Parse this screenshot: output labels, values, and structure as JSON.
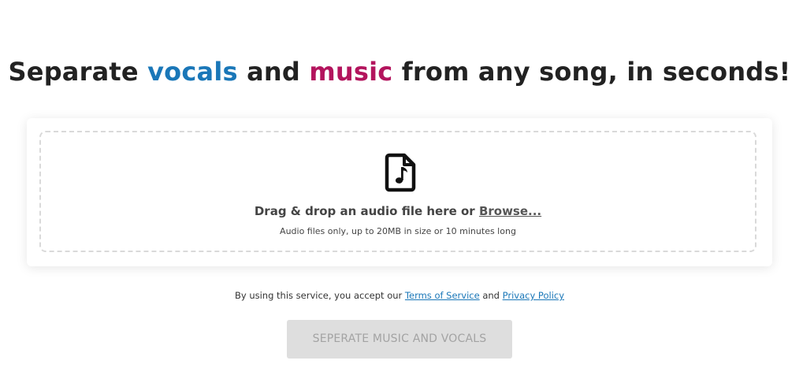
{
  "headline": {
    "part1": "Separate ",
    "vocals": "vocals",
    "part2": " and ",
    "music": "music",
    "part3": " from any song, in seconds!"
  },
  "colors": {
    "vocals_accent": "#1a77b8",
    "music_accent": "#b3145d",
    "button_disabled_bg": "#dedede",
    "button_disabled_text": "#a3a3a3"
  },
  "dropzone": {
    "icon": "audio-file-icon",
    "prompt": "Drag & drop an audio file here or ",
    "browse_label": "Browse...",
    "hint": "Audio files only, up to 20MB in size or 10 minutes long"
  },
  "terms": {
    "prefix": "By using this service, you accept our ",
    "tos_label": "Terms of Service",
    "middle": " and ",
    "privacy_label": "Privacy Policy"
  },
  "submit": {
    "label": "SEPERATE MUSIC AND VOCALS",
    "disabled": true
  }
}
